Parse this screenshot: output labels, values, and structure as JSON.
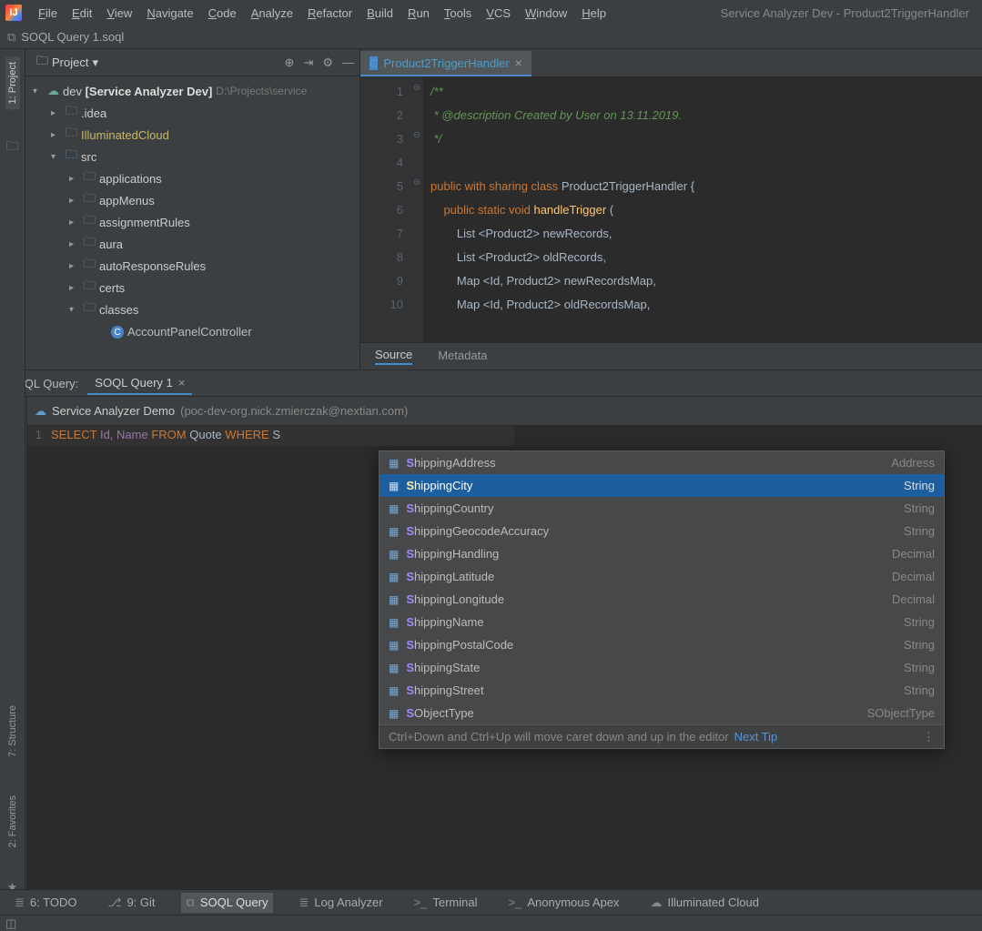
{
  "window_title": "Service Analyzer Dev - Product2TriggerHandler",
  "menu": [
    "File",
    "Edit",
    "View",
    "Navigate",
    "Code",
    "Analyze",
    "Refactor",
    "Build",
    "Run",
    "Tools",
    "VCS",
    "Window",
    "Help"
  ],
  "breadcrumb_file": "SOQL Query 1.soql",
  "project": {
    "selector_label": "Project",
    "root_name": "dev",
    "root_qualifier": "[Service Analyzer Dev]",
    "root_path": "D:\\Projects\\service",
    "folders": [
      ".idea",
      "IlluminatedCloud",
      "src"
    ],
    "src_children": [
      "applications",
      "appMenus",
      "assignmentRules",
      "aura",
      "autoResponseRules",
      "certs",
      "classes"
    ],
    "class_item": "AccountPanelController"
  },
  "editor": {
    "tab_name": "Product2TriggerHandler",
    "line_numbers": [
      1,
      2,
      3,
      4,
      5,
      6,
      7,
      8,
      9,
      10
    ],
    "code": {
      "l1": "/**",
      "l2": " * @description Created by User on 13.11.2019.",
      "l3": " */",
      "l5_kw": "public with sharing class",
      "l5_name": "Product2TriggerHandler",
      "l5_brace": " {",
      "l6_kw1": "public static void",
      "l6_name": "handleTrigger",
      "l6_paren": " (",
      "l7_type": "List <Product2>",
      "l7_var": "newRecords",
      "l8_type": "List <Product2>",
      "l8_var": "oldRecords",
      "l9_type": "Map <Id, Product2>",
      "l9_var": "newRecordsMap",
      "l10_type": "Map <Id, Product2>",
      "l10_var": "oldRecordsMap"
    },
    "bottom_tabs": [
      "Source",
      "Metadata"
    ]
  },
  "soql": {
    "panel_label": "SOQL Query:",
    "tab_name": "SOQL Query 1",
    "connection_name": "Service Analyzer Demo",
    "connection_email": "(poc-dev-org.nick.zmierczak@nextian.com)",
    "query": {
      "line_no": "1",
      "select": "SELECT",
      "fields": "Id, Name",
      "from": "FROM",
      "obj": "Quote",
      "where": "WHERE",
      "typed": "S"
    },
    "autocomplete": [
      {
        "name": "ShippingAddress",
        "type": "Address",
        "sel": false
      },
      {
        "name": "ShippingCity",
        "type": "String",
        "sel": true
      },
      {
        "name": "ShippingCountry",
        "type": "String",
        "sel": false
      },
      {
        "name": "ShippingGeocodeAccuracy",
        "type": "String",
        "sel": false
      },
      {
        "name": "ShippingHandling",
        "type": "Decimal",
        "sel": false
      },
      {
        "name": "ShippingLatitude",
        "type": "Decimal",
        "sel": false
      },
      {
        "name": "ShippingLongitude",
        "type": "Decimal",
        "sel": false
      },
      {
        "name": "ShippingName",
        "type": "String",
        "sel": false
      },
      {
        "name": "ShippingPostalCode",
        "type": "String",
        "sel": false
      },
      {
        "name": "ShippingState",
        "type": "String",
        "sel": false
      },
      {
        "name": "ShippingStreet",
        "type": "String",
        "sel": false
      },
      {
        "name": "SObjectType",
        "type": "SObjectType",
        "sel": false
      }
    ],
    "ac_hint": "Ctrl+Down and Ctrl+Up will move caret down and up in the editor",
    "ac_tip": "Next Tip"
  },
  "sidebar_tabs": {
    "project": "1: Project",
    "structure": "7: Structure",
    "favorites": "2: Favorites"
  },
  "bottom": [
    {
      "label": "6: TODO",
      "ico": "≣"
    },
    {
      "label": "9: Git",
      "ico": "⎇"
    },
    {
      "label": "SOQL Query",
      "ico": "⧉",
      "active": true
    },
    {
      "label": "Log Analyzer",
      "ico": "≣"
    },
    {
      "label": "Terminal",
      "ico": ">_"
    },
    {
      "label": "Anonymous Apex",
      "ico": ">_"
    },
    {
      "label": "Illuminated Cloud",
      "ico": "☁"
    }
  ]
}
